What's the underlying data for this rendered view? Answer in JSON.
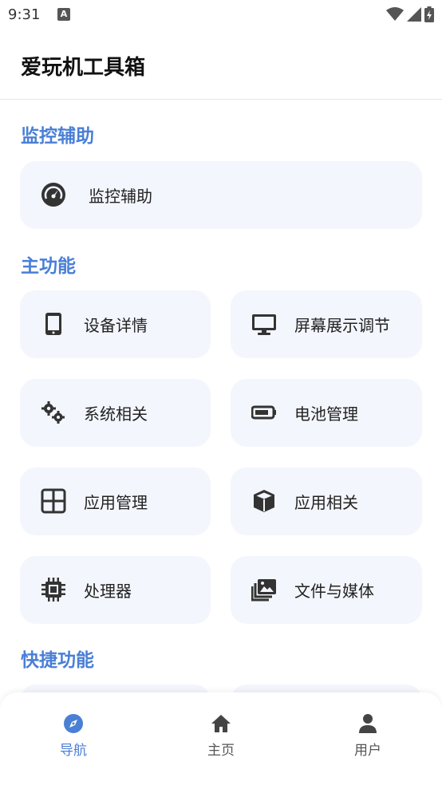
{
  "status_bar": {
    "time": "9:31"
  },
  "app": {
    "title": "爱玩机工具箱"
  },
  "sections": {
    "monitor": {
      "title": "监控辅助",
      "items": [
        "监控辅助"
      ]
    },
    "main": {
      "title": "主功能",
      "items": [
        "设备详情",
        "屏幕展示调节",
        "系统相关",
        "电池管理",
        "应用管理",
        "应用相关",
        "处理器",
        "文件与媒体"
      ]
    },
    "quick": {
      "title": "快捷功能"
    }
  },
  "nav": {
    "items": [
      "导航",
      "主页",
      "用户"
    ],
    "active": "导航"
  },
  "colors": {
    "accent": "#4a7fd6",
    "card_bg": "#f3f6fc",
    "icon": "#333333"
  }
}
